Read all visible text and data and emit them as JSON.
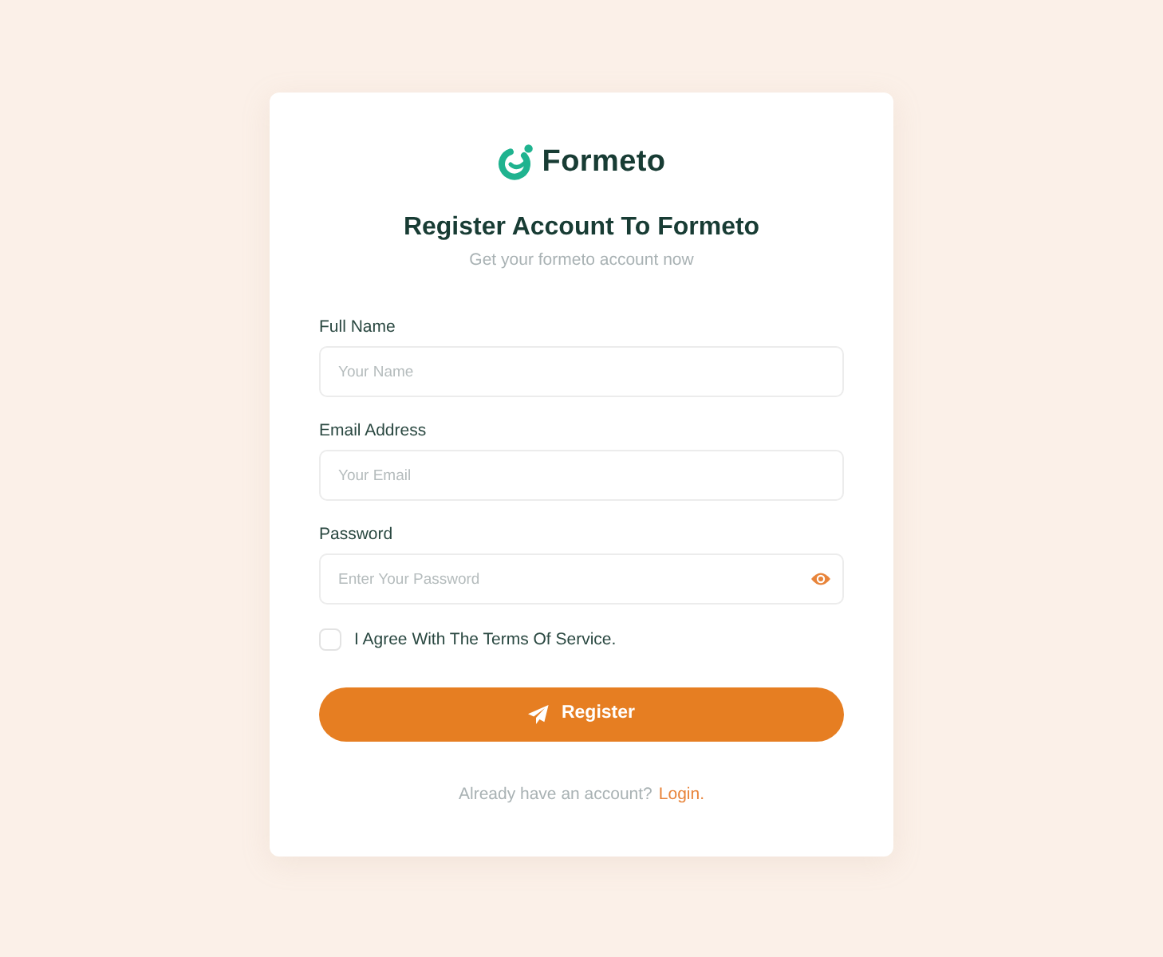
{
  "logo": {
    "text": "Formeto"
  },
  "heading": {
    "title": "Register Account To Formeto",
    "subtitle": "Get your formeto account now"
  },
  "fields": [
    {
      "kind": "text",
      "label": "Full Name",
      "placeholder": "Your Name"
    },
    {
      "kind": "email",
      "label": "Email Address",
      "placeholder": "Your Email"
    },
    {
      "kind": "password",
      "label": "Password",
      "placeholder": "Enter Your Password"
    }
  ],
  "terms": {
    "label": "I Agree With The Terms Of Service.",
    "checked": false
  },
  "submit": {
    "label": "Register"
  },
  "footer": {
    "text": "Already have an account?",
    "link": "Login."
  }
}
